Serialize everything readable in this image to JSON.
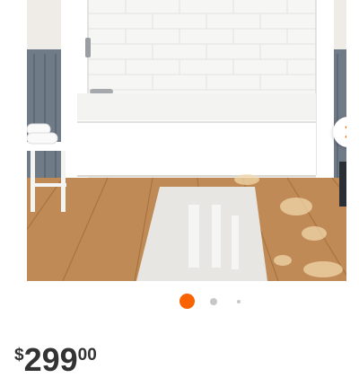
{
  "gallery": {
    "image_icon": "bathtub-product-photo",
    "next_icon": "chevron-right-icon",
    "active_index": 1,
    "slides_visible": 3
  },
  "price": {
    "currency_symbol": "$",
    "dollars": "299",
    "cents": "00"
  },
  "colors": {
    "accent": "#f96302",
    "dot_inactive": "#c8c8c8",
    "price_text": "#333333"
  }
}
